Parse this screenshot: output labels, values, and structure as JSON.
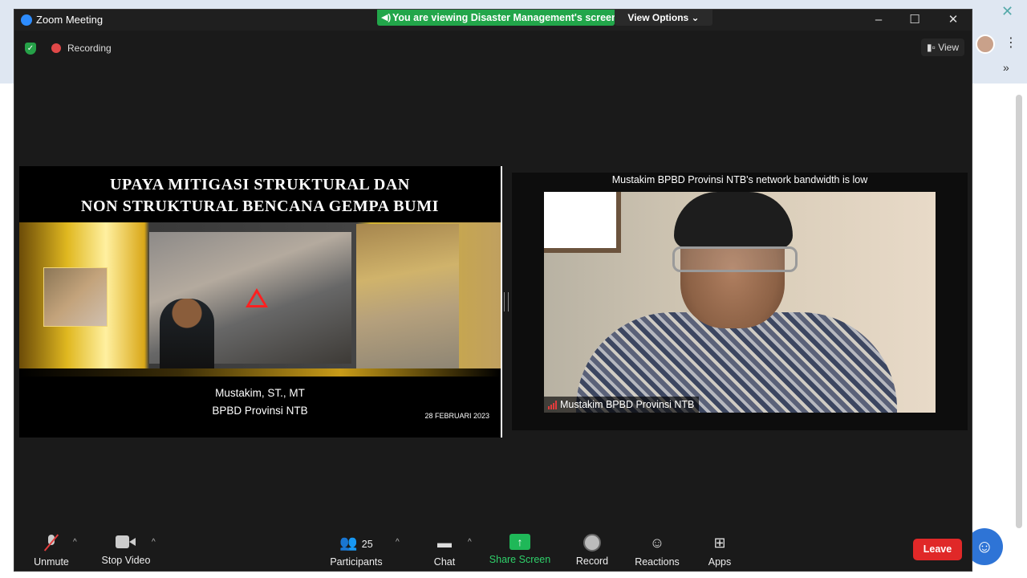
{
  "window": {
    "title": "Zoom Meeting"
  },
  "share_banner": {
    "text": "You are viewing Disaster Management's screen",
    "view_options": "View Options ⌄"
  },
  "meeting": {
    "recording": "Recording",
    "view": "View"
  },
  "slide": {
    "title_line1": "UPAYA MITIGASI STRUKTURAL DAN",
    "title_line2": "NON STRUKTURAL BENCANA GEMPA BUMI",
    "author": "Mustakim, ST., MT",
    "org": "BPBD Provinsi NTB",
    "date": "28 FEBRUARI 2023"
  },
  "video": {
    "bandwidth_warning": "Mustakim BPBD Provinsi NTB's network bandwidth is low",
    "name": "Mustakim BPBD Provinsi NTB"
  },
  "toolbar": {
    "unmute": "Unmute",
    "stop_video": "Stop Video",
    "participants": "Participants",
    "participant_count": "25",
    "chat": "Chat",
    "share_screen": "Share Screen",
    "record": "Record",
    "reactions": "Reactions",
    "apps": "Apps",
    "leave": "Leave"
  },
  "colors": {
    "share_green": "#22a64a",
    "leave_red": "#e02828",
    "zoom_blue": "#2d8cff"
  }
}
